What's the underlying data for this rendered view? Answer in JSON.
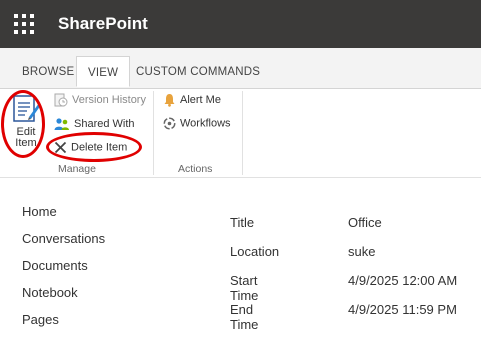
{
  "app": {
    "title": "SharePoint"
  },
  "tabs": [
    {
      "label": "BROWSE",
      "active": false
    },
    {
      "label": "VIEW",
      "active": true
    },
    {
      "label": "CUSTOM COMMANDS",
      "active": false
    }
  ],
  "ribbon": {
    "manage": {
      "group_label": "Manage",
      "edit_item": "Edit Item",
      "edit_item_line1": "Edit",
      "edit_item_line2": "Item",
      "version_history": "Version History",
      "shared_with": "Shared With",
      "delete_item": "Delete Item"
    },
    "actions": {
      "group_label": "Actions",
      "alert_me": "Alert Me",
      "workflows": "Workflows"
    }
  },
  "nav": {
    "items": [
      "Home",
      "Conversations",
      "Documents",
      "Notebook",
      "Pages"
    ]
  },
  "item": {
    "fields": [
      {
        "label": "Title",
        "value": "Office"
      },
      {
        "label": "Location",
        "value": "suke"
      },
      {
        "label": "Start Time",
        "value": "4/9/2025 12:00 AM"
      },
      {
        "label": "End Time",
        "value": "4/9/2025 11:59 PM"
      }
    ]
  },
  "icons": {
    "app_launcher": "waffle-icon",
    "edit_item": "edit-document-icon",
    "version_history": "version-history-icon",
    "shared_with": "people-icon",
    "delete_item": "x-delete-icon",
    "alert_me": "bell-icon",
    "workflows": "workflow-icon"
  },
  "colors": {
    "suite_bar": "#3b3a39",
    "annotation": "#e00000"
  }
}
